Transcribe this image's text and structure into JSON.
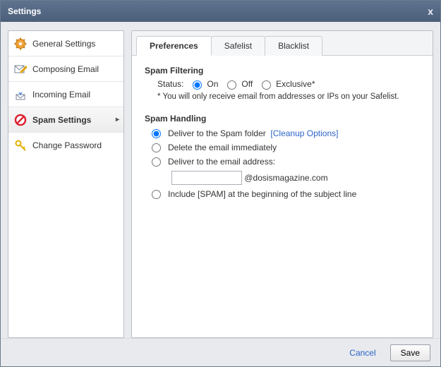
{
  "title": "Settings",
  "sidebar": {
    "items": [
      {
        "label": "General Settings"
      },
      {
        "label": "Composing Email"
      },
      {
        "label": "Incoming Email"
      },
      {
        "label": "Spam Settings"
      },
      {
        "label": "Change Password"
      }
    ]
  },
  "tabs": [
    {
      "label": "Preferences"
    },
    {
      "label": "Safelist"
    },
    {
      "label": "Blacklist"
    }
  ],
  "spam_filtering": {
    "title": "Spam Filtering",
    "status_label": "Status:",
    "options": {
      "on": "On",
      "off": "Off",
      "exclusive": "Exclusive*"
    },
    "note": "* You will only receive email from addresses or IPs on your Safelist."
  },
  "spam_handling": {
    "title": "Spam Handling",
    "deliver_folder": "Deliver to the Spam folder",
    "cleanup_link": "[Cleanup Options]",
    "delete_immediately": "Delete the email immediately",
    "deliver_address": "Deliver to the email address:",
    "domain_suffix": "@dosismagazine.com",
    "include_spam_tag": "Include [SPAM] at the beginning of the subject line"
  },
  "buttons": {
    "cancel": "Cancel",
    "save": "Save"
  }
}
